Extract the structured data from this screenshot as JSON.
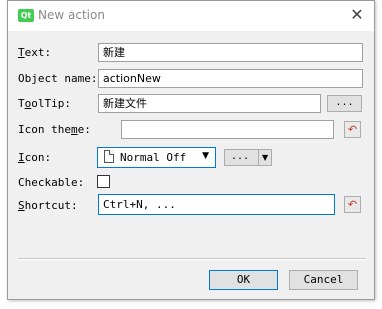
{
  "window": {
    "title": "New action",
    "app_icon_text": "Qt",
    "close_glyph": "✕"
  },
  "form": {
    "text": {
      "label_prefix": "",
      "label_mnemonic": "T",
      "label_rest": "ext:",
      "value": "新建"
    },
    "object_name": {
      "label": "Object name:",
      "value": "actionNew"
    },
    "tooltip": {
      "label_prefix": "T",
      "label_mnemonic": "o",
      "label_rest": "olTip:",
      "value": "新建文件",
      "button": "..."
    },
    "icon_theme": {
      "label_prefix": "Icon the",
      "label_mnemonic": "m",
      "label_rest": "e:",
      "value": ""
    },
    "icon": {
      "label_prefix": "",
      "label_mnemonic": "I",
      "label_rest": "con:",
      "combo_value": "Normal Off",
      "browse_button": "...",
      "dropdown_glyph": "▼"
    },
    "checkable": {
      "label": "Checkable:",
      "checked": false
    },
    "shortcut": {
      "label_prefix": "",
      "label_mnemonic": "S",
      "label_rest": "hortcut:",
      "value": "Ctrl+N, ..."
    },
    "reset_glyph": "↶"
  },
  "buttons": {
    "ok": "OK",
    "cancel": "Cancel"
  },
  "colors": {
    "accent": "#0078d7",
    "reset_icon": "#c0392b",
    "qt_green": "#41cd52"
  }
}
